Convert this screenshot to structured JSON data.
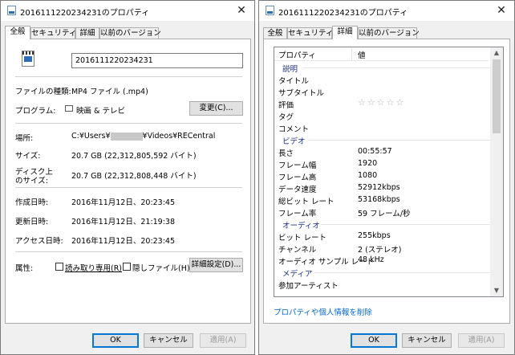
{
  "left_window": {
    "title": "20161112202342​31のプロパティ",
    "tabs": [
      "全般",
      "セキュリティ",
      "詳細",
      "以前のバージョン"
    ],
    "file_name": "20161112202342​31",
    "rows": {
      "file_type_label": "ファイルの種類:",
      "file_type_value": "MP4 ファイル (.mp4)",
      "program_label": "プログラム:",
      "program_value": "映画 & テレビ",
      "change_button": "変更(C)...",
      "location_label": "場所:",
      "location_prefix": "C:¥Users¥",
      "location_suffix": "¥Videos¥RECentral",
      "size_label": "サイズ:",
      "size_value": "20.7 GB (22,312,805,592 バイト)",
      "disk_size_label_1": "ディスク上",
      "disk_size_label_2": "のサイズ:",
      "disk_size_value": "20.7 GB (22,312,808,448 バイト)",
      "created_label": "作成日時:",
      "created_value": "2016年11月12日、20:23:45",
      "modified_label": "更新日時:",
      "modified_value": "2016年11月12日、21:19:38",
      "accessed_label": "アクセス日時:",
      "accessed_value": "2016年11月12日、20:23:45",
      "attributes_label": "属性:",
      "readonly_label": "読み取り専用(R)",
      "hidden_label": "隠しファイル(H)",
      "advanced_button": "詳細設定(D)..."
    },
    "buttons": {
      "ok": "OK",
      "cancel": "キャンセル",
      "apply": "適用(A)"
    }
  },
  "right_window": {
    "title": "20161112202342​31のプロパティ",
    "tabs": [
      "全般",
      "セキュリティ",
      "詳細",
      "以前のバージョン"
    ],
    "header": {
      "property": "プロパティ",
      "value": "値"
    },
    "groups": {
      "description": "説明",
      "video": "ビデオ",
      "audio": "オーディオ",
      "media": "メディア"
    },
    "description_rows": [
      "タイトル",
      "サブタイトル",
      "評価",
      "タグ",
      "コメント"
    ],
    "rating_stars": "☆☆☆☆☆",
    "video_rows": [
      {
        "name": "長さ",
        "value": "00:55:57"
      },
      {
        "name": "フレーム幅",
        "value": "1920"
      },
      {
        "name": "フレーム高",
        "value": "1080"
      },
      {
        "name": "データ速度",
        "value": "52912kbps"
      },
      {
        "name": "総ビット レート",
        "value": "53168kbps"
      },
      {
        "name": "フレーム率",
        "value": "59 フレーム/秒"
      }
    ],
    "audio_rows": [
      {
        "name": "ビット レート",
        "value": "255kbps"
      },
      {
        "name": "チャンネル",
        "value": "2 (ステレオ)"
      },
      {
        "name": "オーディオ サンプル レート",
        "value": "48 kHz"
      }
    ],
    "media_rows": [
      "参加アーティスト"
    ],
    "remove_link": "プロパティや個人情報を削除",
    "buttons": {
      "ok": "OK",
      "cancel": "キャンセル",
      "apply": "適用(A)"
    }
  }
}
